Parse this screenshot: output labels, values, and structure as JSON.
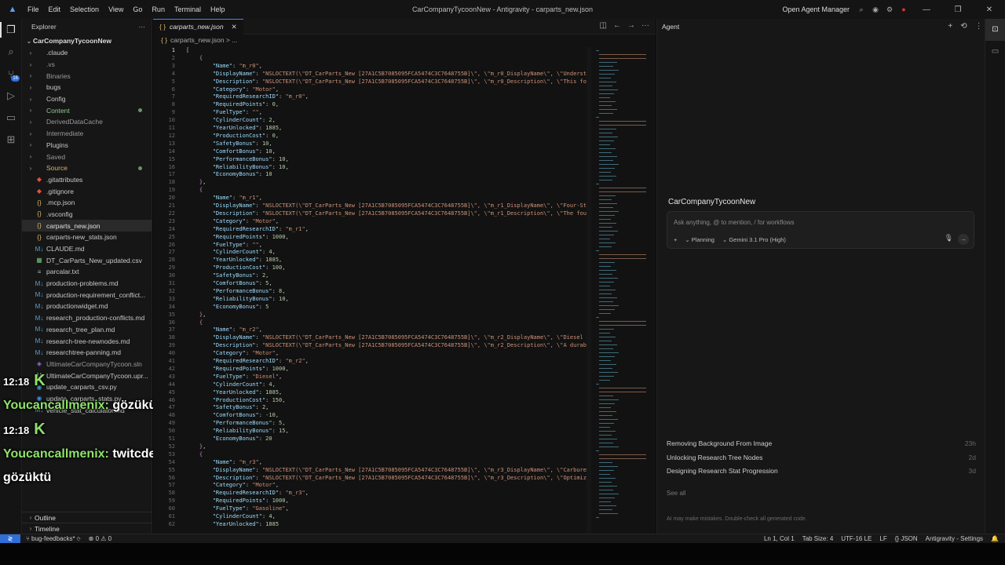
{
  "menu": [
    "File",
    "Edit",
    "Selection",
    "View",
    "Go",
    "Run",
    "Terminal",
    "Help"
  ],
  "window_title": "CarCompanyTycoonNew - Antigravity - carparts_new.json",
  "open_agent_manager": "Open Agent Manager",
  "explorer": {
    "title": "Explorer",
    "root": "CarCompanyTycoonNew",
    "items": [
      {
        "label": ".claude",
        "type": "folder",
        "color": "#c8c8c8"
      },
      {
        "label": ".vs",
        "type": "folder",
        "color": "#9a9a9a"
      },
      {
        "label": "Binaries",
        "type": "folder",
        "color": "#9a9a9a"
      },
      {
        "label": "bugs",
        "type": "folder",
        "color": "#c8c8c8"
      },
      {
        "label": "Config",
        "type": "folder",
        "color": "#c8c8c8"
      },
      {
        "label": "Content",
        "type": "folder",
        "color": "#8fc98f",
        "dot": true
      },
      {
        "label": "DerivedDataCache",
        "type": "folder",
        "color": "#9a9a9a"
      },
      {
        "label": "Intermediate",
        "type": "folder",
        "color": "#9a9a9a"
      },
      {
        "label": "Plugins",
        "type": "folder",
        "color": "#c8c8c8"
      },
      {
        "label": "Saved",
        "type": "folder",
        "color": "#9a9a9a"
      },
      {
        "label": "Source",
        "type": "folder",
        "color": "#d9b56a",
        "dot": true
      },
      {
        "label": ".gitattributes",
        "type": "git",
        "color": "#c8c8c8"
      },
      {
        "label": ".gitignore",
        "type": "git",
        "color": "#c8c8c8"
      },
      {
        "label": ".mcp.json",
        "type": "json",
        "color": "#c8c8c8"
      },
      {
        "label": ".vsconfig",
        "type": "json",
        "color": "#c8c8c8"
      },
      {
        "label": "carparts_new.json",
        "type": "json",
        "color": "#e0e0e0",
        "selected": true
      },
      {
        "label": "carparts-new_stats.json",
        "type": "json",
        "color": "#c8c8c8"
      },
      {
        "label": "CLAUDE.md",
        "type": "md",
        "color": "#c8c8c8"
      },
      {
        "label": "DT_CarParts_New_updated.csv",
        "type": "csv",
        "color": "#c8c8c8"
      },
      {
        "label": "parcalar.txt",
        "type": "txt",
        "color": "#c8c8c8"
      },
      {
        "label": "production-problems.md",
        "type": "md",
        "color": "#c8c8c8"
      },
      {
        "label": "production-requirement_conflict...",
        "type": "md",
        "color": "#c8c8c8"
      },
      {
        "label": "productionwidget.md",
        "type": "md",
        "color": "#c8c8c8"
      },
      {
        "label": "research_production-conflicts.md",
        "type": "md",
        "color": "#c8c8c8"
      },
      {
        "label": "research_tree_plan.md",
        "type": "md",
        "color": "#c8c8c8"
      },
      {
        "label": "research-tree-newnodes.md",
        "type": "md",
        "color": "#c8c8c8"
      },
      {
        "label": "researchtree-panning.md",
        "type": "md",
        "color": "#c8c8c8"
      },
      {
        "label": "UltimateCarCompanyTycoon.sln",
        "type": "sln",
        "color": "#9a9a9a"
      },
      {
        "label": "UltimateCarCompanyTycoon.upr...",
        "type": "uproject",
        "color": "#c8c8c8"
      },
      {
        "label": "update_carparts_csv.py",
        "type": "py",
        "color": "#c8c8c8"
      },
      {
        "label": "update_carparts_stats.py",
        "type": "py",
        "color": "#c8c8c8"
      },
      {
        "label": "vehicle_stat_calculator.md",
        "type": "md",
        "color": "#c8c8c8"
      }
    ],
    "outline": "Outline",
    "timeline": "Timeline"
  },
  "chat": [
    {
      "time": "12:18",
      "user": "Youcancallmenix:",
      "message": "gözüküyo"
    },
    {
      "time": "12:18",
      "user": "Youcancallmenix:",
      "message": "twitcdeki gözüktü"
    }
  ],
  "editor": {
    "tab": "carparts_new.json",
    "breadcrumb": "carparts_new.json > ...",
    "parts": [
      {
        "Name": "m_r0",
        "DisplayName": "NSLOCTEXT(\\\"DT_CarParts_New [27A1C5B7085095FCA5474C3C7648755B]\\\", \\\"m_r0_DisplayName\\\", \\\"Understanding",
        "Description": "NSLOCTEXT(\\\"DT_CarParts_New [27A1C5B7085095FCA5474C3C7648755B]\\\", \\\"m_r0_Description\\\", \\\"This foundat",
        "Category": "Motor",
        "RequiredResearchID": "m_r0",
        "RequiredPoints": "0",
        "FuelType": "",
        "CylinderCount": "2",
        "YearUnlocked": "1885",
        "ProductionCost": "0",
        "SafetyBonus": "10",
        "ComfortBonus": "10",
        "PerformanceBonus": "10",
        "ReliabilityBonus": "10",
        "EconomyBonus": "10"
      },
      {
        "Name": "m_r1",
        "DisplayName": "NSLOCTEXT(\\\"DT_CarParts_New [27A1C5B7085095FCA5474C3C7648755B]\\\", \\\"m_r1_DisplayName\\\", \\\"Four-Stroke",
        "Description": "NSLOCTEXT(\\\"DT_CarParts_New [27A1C5B7085095FCA5474C3C7648755B]\\\", \\\"m_r1_Description\\\", \\\"The foundati",
        "Category": "Motor",
        "RequiredResearchID": "m_r1",
        "RequiredPoints": "1000",
        "FuelType": "",
        "CylinderCount": "4",
        "YearUnlocked": "1885",
        "ProductionCost": "100",
        "SafetyBonus": "2",
        "ComfortBonus": "5",
        "PerformanceBonus": "8",
        "ReliabilityBonus": "10",
        "EconomyBonus": "5"
      },
      {
        "Name": "m_r2",
        "DisplayName": "NSLOCTEXT(\\\"DT_CarParts_New [27A1C5B7085095FCA5474C3C7648755B]\\\", \\\"m_r2_DisplayName\\\", \\\"Diesel Engin",
        "Description": "NSLOCTEXT(\\\"DT_CarParts_New [27A1C5B7085095FCA5474C3C7648755B]\\\", \\\"m_r2_Description\\\", \\\"A durable eng",
        "Category": "Motor",
        "RequiredResearchID": "m_r2",
        "RequiredPoints": "1000",
        "FuelType": "Diesel",
        "CylinderCount": "4",
        "YearUnlocked": "1885",
        "ProductionCost": "150",
        "SafetyBonus": "2",
        "ComfortBonus": "-10",
        "PerformanceBonus": "5",
        "ReliabilityBonus": "15",
        "EconomyBonus": "20"
      },
      {
        "Name": "m_r3",
        "DisplayName": "NSLOCTEXT(\\\"DT_CarParts_New [27A1C5B7085095FCA5474C3C7648755B]\\\", \\\"m_r3_DisplayName\\\", \\\"Carburetor D",
        "Description": "NSLOCTEXT(\\\"DT_CarParts_New [27A1C5B7085095FCA5474C3C7648755B]\\\", \\\"m_r3_Description\\\", \\\"Optimizes co",
        "Category": "Motor",
        "RequiredResearchID": "m_r3",
        "RequiredPoints": "1000",
        "FuelType": "Gasoline",
        "CylinderCount": "4",
        "YearUnlocked": "1885"
      }
    ]
  },
  "agent": {
    "title": "Agent",
    "project": "CarCompanyTycoonNew",
    "placeholder": "Ask anything, @ to mention, / for workflows",
    "mode": "Planning",
    "model": "Gemini 3.1 Pro (High)",
    "conversations": [
      {
        "title": "Removing Background From Image",
        "time": "23h"
      },
      {
        "title": "Unlocking Research Tree Nodes",
        "time": "2d"
      },
      {
        "title": "Designing Research Stat Progression",
        "time": "3d"
      }
    ],
    "see_all": "See all",
    "disclaimer": "AI may make mistakes. Double-check all generated code."
  },
  "status": {
    "branch": "bug-feedbacks*",
    "problems": "0",
    "warnings": "0",
    "position": "Ln 1, Col 1",
    "tab_size": "Tab Size: 4",
    "encoding": "UTF-16 LE",
    "eol": "LF",
    "language": "JSON",
    "settings": "Antigravity - Settings"
  }
}
